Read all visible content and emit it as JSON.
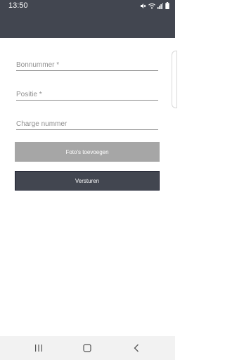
{
  "status_bar": {
    "time": "13:50",
    "icons": [
      "mute-icon",
      "wifi-icon",
      "signal-icon",
      "battery-icon"
    ]
  },
  "form": {
    "bon_number": {
      "placeholder": "Bonnummer *",
      "value": ""
    },
    "position": {
      "placeholder": "Positie *",
      "value": ""
    },
    "charge_number": {
      "placeholder": "Charge nummer",
      "value": ""
    }
  },
  "buttons": {
    "add_photos": "Foto's toevoegen",
    "send": "Versturen"
  },
  "nav_bar": {
    "icons": [
      "recent-apps-icon",
      "home-icon",
      "back-icon"
    ]
  },
  "colors": {
    "header": "#424650",
    "photo_button": "#a6a6a6",
    "send_button": "#424650",
    "navbar": "#f2f2f2"
  }
}
